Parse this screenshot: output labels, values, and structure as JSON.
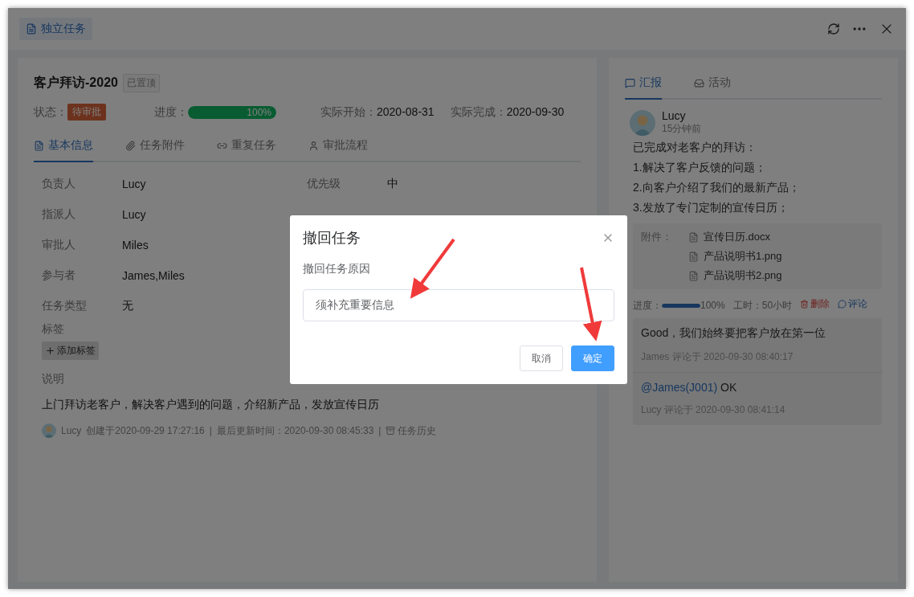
{
  "header": {
    "tag": "独立任务"
  },
  "task": {
    "title": "客户拜访-2020",
    "pin_tag": "已置顶",
    "status_label": "状态：",
    "status": "待审批",
    "progress_label": "进度：",
    "progress": {
      "level": 1,
      "reading": "100%"
    },
    "dates": [
      {
        "label": "实际开始：",
        "value": "2020-08-31"
      },
      {
        "label": "实际完成：",
        "value": "2020-09-30"
      }
    ]
  },
  "tabs": [
    {
      "kind": "info",
      "label": "基本信息",
      "selected": true
    },
    {
      "kind": "attach",
      "label": "任务附件",
      "selected": false
    },
    {
      "kind": "repeat",
      "label": "重复任务",
      "selected": false
    },
    {
      "kind": "approve",
      "label": "审批流程",
      "selected": false
    }
  ],
  "fields": [
    [
      {
        "label": "负责人",
        "value": "Lucy"
      },
      {
        "label": "优先级",
        "value": "中"
      }
    ],
    [
      {
        "label": "指派人",
        "value": "Lucy"
      }
    ],
    [
      {
        "label": "审批人",
        "value": "Miles"
      }
    ],
    [
      {
        "label": "参与者",
        "value": "James,Miles"
      }
    ],
    [
      {
        "label": "任务类型",
        "value": "无"
      }
    ]
  ],
  "tags": {
    "label": "标签",
    "add_button": "添加标签"
  },
  "description": {
    "label": "说明",
    "text": "上门拜访老客户，解决客户遇到的问题，介绍新产品，发放宣传日历"
  },
  "footer": {
    "user": "Lucy",
    "created": "创建于2020-09-29 17:27:16",
    "separator_1": "|",
    "updated": "最后更新时间：2020-09-30 08:45:33",
    "separator_2": "|",
    "history_link": "任务历史"
  },
  "side_tabs": [
    {
      "kind": "report",
      "label": "汇报",
      "selected": true
    },
    {
      "kind": "activity",
      "label": "活动",
      "selected": false
    }
  ],
  "report": {
    "user": "Lucy",
    "time": "15分钟前",
    "lines": [
      "已完成对老客户的拜访：",
      "1.解决了客户反馈的问题；",
      "2.向客户介绍了我们的最新产品；",
      "3.发放了专门定制的宣传日历；"
    ],
    "attachments_label": "附件：",
    "attachments": [
      "宣传日历.docx",
      "产品说明书1.png",
      "产品说明书2.png"
    ],
    "progress_label": "进度：",
    "progress": {
      "level": 1,
      "reading": "100%"
    },
    "hours": "工时：50小时",
    "delete": "删除",
    "comment": "评论",
    "comments": [
      {
        "text": "Good，我们始终要把客户放在第一位",
        "meta": "James 评论于 2020-09-30 08:40:17"
      },
      {
        "mention": "@James(J001)",
        "text": " OK",
        "meta": "Lucy 评论于 2020-09-30 08:41:14"
      }
    ]
  },
  "dialog": {
    "title": "撤回任务",
    "field_label": "撤回任务原因",
    "value": "须补充重要信息",
    "buttons": [
      {
        "kind": "cancel",
        "label": "取消"
      },
      {
        "kind": "primary",
        "label": "确定"
      }
    ]
  }
}
